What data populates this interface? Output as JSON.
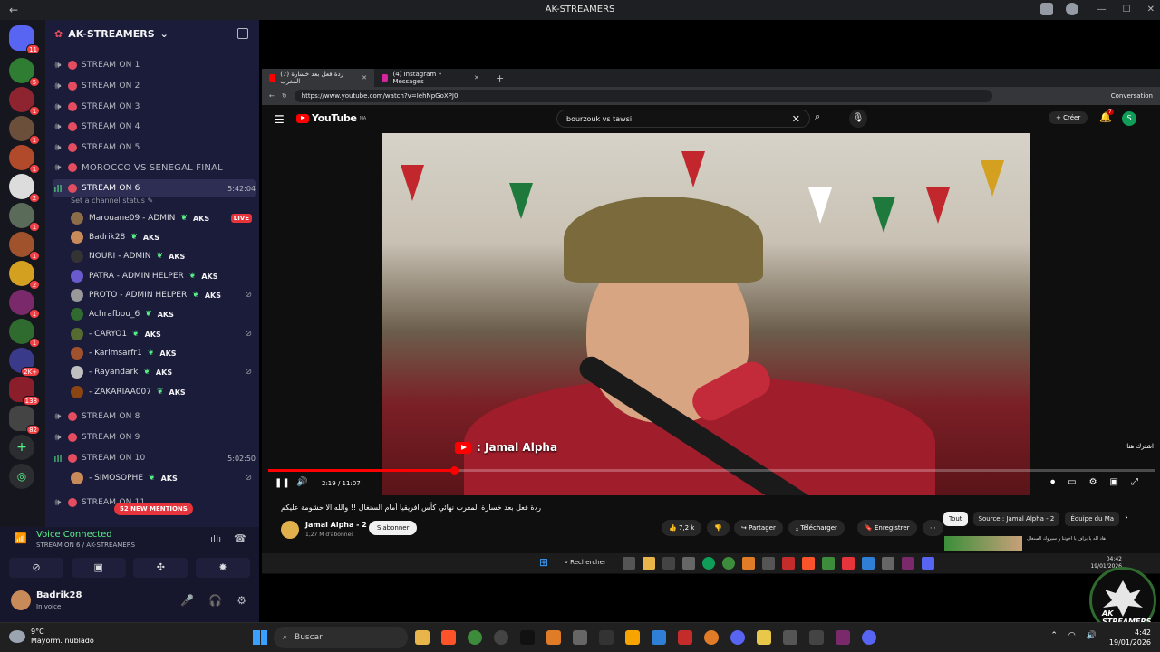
{
  "window": {
    "title": "AK-STREAMERS"
  },
  "server": {
    "name": "AK-STREAMERS"
  },
  "guild_badges": [
    "11",
    "5",
    "1",
    "1",
    "1",
    "2",
    "1",
    "1",
    "2",
    "1",
    "1",
    "2K+",
    "138",
    "82"
  ],
  "channels": [
    {
      "name": "STREAM ON 1"
    },
    {
      "name": "STREAM ON 2"
    },
    {
      "name": "STREAM ON 3"
    },
    {
      "name": "STREAM ON 4"
    },
    {
      "name": "STREAM ON 5"
    },
    {
      "name": "MOROCCO VS SENEGAL FINAL"
    },
    {
      "name": "STREAM ON 6",
      "time": "5:42:04",
      "status": "Set a channel status"
    }
  ],
  "members": [
    {
      "name": "Marouane09 - ADMIN",
      "tag": "AKS",
      "live": "LIVE"
    },
    {
      "name": "Badrik28",
      "tag": "AKS"
    },
    {
      "name": "NOURI - ADMIN",
      "tag": "AKS"
    },
    {
      "name": "PATRA - ADMIN HELPER",
      "tag": "AKS"
    },
    {
      "name": "PROTO - ADMIN HELPER",
      "tag": "AKS"
    },
    {
      "name": "Achrafbou_6",
      "tag": "AKS"
    },
    {
      "name": "- CARYO1",
      "tag": "AKS"
    },
    {
      "name": "- Karimsarfr1",
      "tag": "AKS"
    },
    {
      "name": "- Rayandark",
      "tag": "AKS"
    },
    {
      "name": "- ZAKARIAA007",
      "tag": "AKS"
    }
  ],
  "channels2": [
    {
      "name": "STREAM ON 8"
    },
    {
      "name": "STREAM ON 9"
    },
    {
      "name": "STREAM ON 10",
      "time": "5:02:50"
    }
  ],
  "member10": {
    "name": "- SIMOSOPHE",
    "tag": "AKS"
  },
  "channel_partial": "STREAM ON 11",
  "mentions": "52 NEW MENTIONS",
  "voice": {
    "title": "Voice Connected",
    "sub": "STREAM ON 6 / AK-STREAMERS"
  },
  "user": {
    "name": "Badrik28",
    "status": "In voice"
  },
  "browser": {
    "tab1": "(7) ردة فعل بعد خسارة المغرب",
    "tab2": "(4) Instagram • Messages",
    "url": "https://www.youtube.com/watch?v=IehNpGoXPJ0",
    "conversation": "Conversation"
  },
  "youtube": {
    "logo": "YouTube",
    "logo_region": "MA",
    "search_value": "bourzouk vs tawsi",
    "create": "Créer",
    "notifications": "7",
    "account": "S",
    "watermark": ": Jamal Alpha",
    "time": "2:19 / 11:07",
    "progress": 0.21,
    "video_title": "ردة فعل بعد خسارة المغرب نهائي كأس افريقيا أمام السنغال !! والله الا حشومة عليكم",
    "channel": "Jamal Alpha - 2",
    "subs": "1,27 M d'abonnés",
    "subscribe": "S'abonner",
    "likes": "7,2 k",
    "share": "Partager",
    "download": "Télécharger",
    "save": "Enregistrer",
    "chips": [
      "Tout",
      "Source : Jamal Alpha - 2",
      "Équipe du Ma"
    ],
    "side_text": "اشترك هنا",
    "thumb_text": "هاد لله يا بزاف يا اخوتنا و سيروك السنغال"
  },
  "inner_taskbar": {
    "search": "Rechercher",
    "time": "04:42",
    "date": "19/01/2026"
  },
  "logo": {
    "text": "AK STREAMERS"
  },
  "taskbar": {
    "weather_temp": "9°C",
    "weather_desc": "Mayorm. nublado",
    "search": "Buscar",
    "time": "4:42",
    "date": "19/01/2026"
  }
}
